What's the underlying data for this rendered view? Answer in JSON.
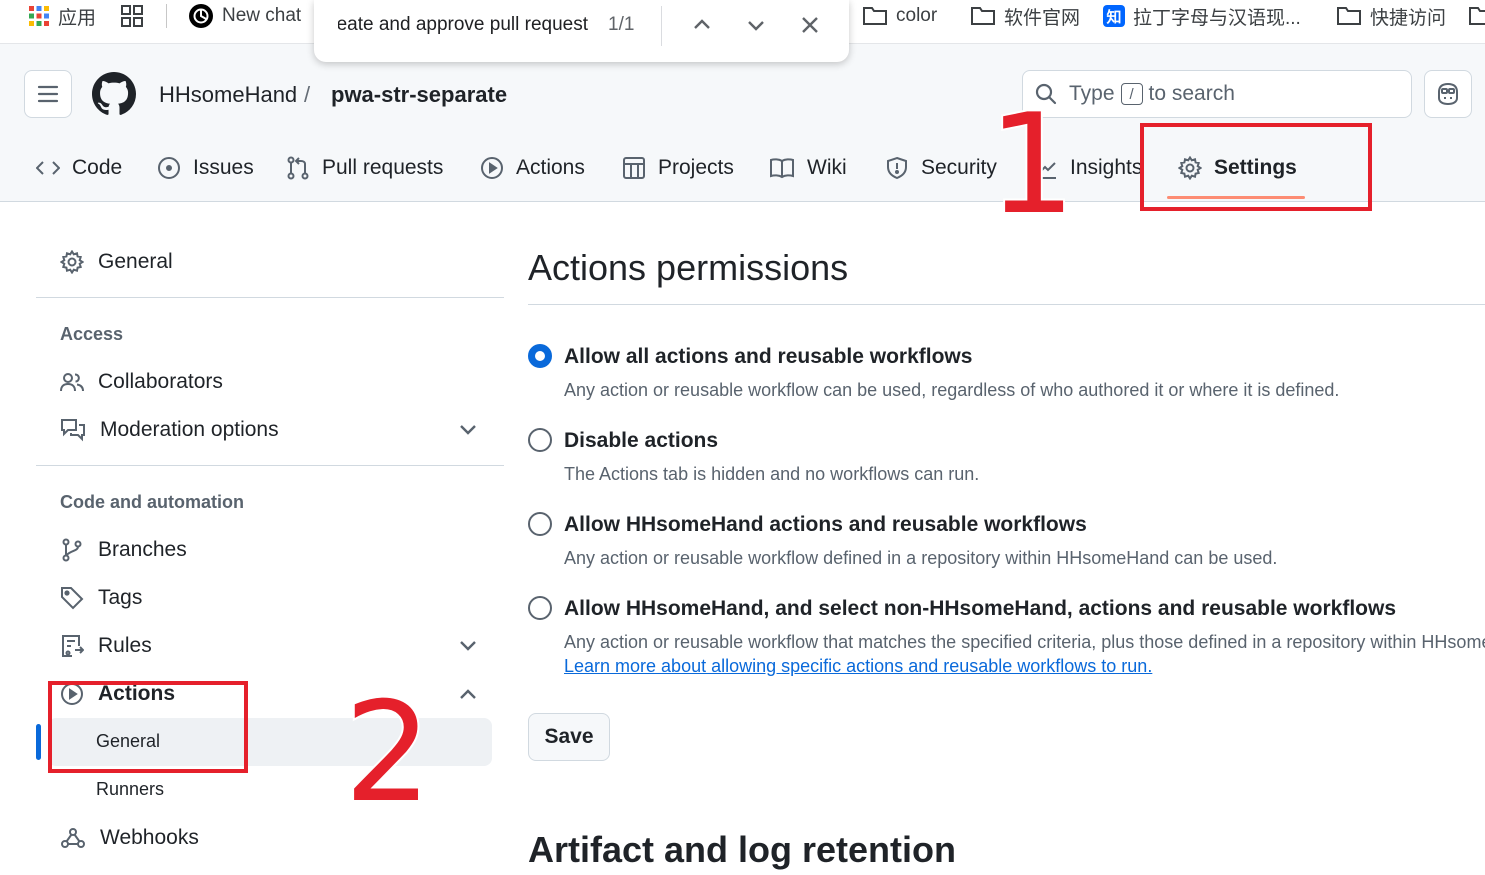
{
  "bookmarks": [
    {
      "label": "应用",
      "icon": "apps-grid-icon"
    },
    {
      "label": "",
      "icon": "tab-groups-icon"
    },
    {
      "label": "New chat",
      "icon": "openai-icon"
    },
    {
      "label": "color",
      "icon": "folder-icon"
    },
    {
      "label": "软件官网",
      "icon": "folder-icon"
    },
    {
      "label": "拉丁字母与汉语现...",
      "icon": "zhihu-icon",
      "icon_text": "知"
    },
    {
      "label": "快捷访问",
      "icon": "folder-icon"
    }
  ],
  "find_bar": {
    "query": "Allow GitHub Actions to create and approve pull request",
    "count": "1/1"
  },
  "repo": {
    "owner": "HHsomeHand",
    "separator": "/",
    "name": "pwa-str-separate"
  },
  "search": {
    "prefix": "Type",
    "key": "/",
    "suffix": "to search"
  },
  "tabs": [
    {
      "label": "Code",
      "icon": "code-icon"
    },
    {
      "label": "Issues",
      "icon": "issue-icon"
    },
    {
      "label": "Pull requests",
      "icon": "pull-request-icon"
    },
    {
      "label": "Actions",
      "icon": "play-icon"
    },
    {
      "label": "Projects",
      "icon": "table-icon"
    },
    {
      "label": "Wiki",
      "icon": "book-icon"
    },
    {
      "label": "Security",
      "icon": "shield-icon"
    },
    {
      "label": "Insights",
      "icon": "graph-icon"
    },
    {
      "label": "Settings",
      "icon": "gear-icon",
      "active": true
    }
  ],
  "annotations": {
    "one": "1",
    "two": "2",
    "color": "#e5202b"
  },
  "sidebar": {
    "general": "General",
    "access_heading": "Access",
    "collaborators": "Collaborators",
    "moderation": "Moderation options",
    "code_heading": "Code and automation",
    "branches": "Branches",
    "tags": "Tags",
    "rules": "Rules",
    "actions": "Actions",
    "actions_general": "General",
    "actions_runners": "Runners",
    "webhooks": "Webhooks"
  },
  "main": {
    "title": "Actions permissions",
    "options": [
      {
        "label": "Allow all actions and reusable workflows",
        "desc": "Any action or reusable workflow can be used, regardless of who authored it or where it is defined.",
        "checked": true
      },
      {
        "label": "Disable actions",
        "desc": "The Actions tab is hidden and no workflows can run.",
        "checked": false
      },
      {
        "label": "Allow HHsomeHand actions and reusable workflows",
        "desc": "Any action or reusable workflow defined in a repository within HHsomeHand can be used.",
        "checked": false
      },
      {
        "label": "Allow HHsomeHand, and select non-HHsomeHand, actions and reusable workflows",
        "desc": "Any action or reusable workflow that matches the specified criteria, plus those defined in a repository within HHsomeHand can be used.",
        "link": "Learn more about allowing specific actions and reusable workflows to run.",
        "checked": false
      }
    ],
    "save": "Save",
    "section2_title": "Artifact and log retention"
  },
  "colors": {
    "accent": "#0969da",
    "tab_underline": "#fd8c73",
    "annotation": "#e5202b"
  }
}
